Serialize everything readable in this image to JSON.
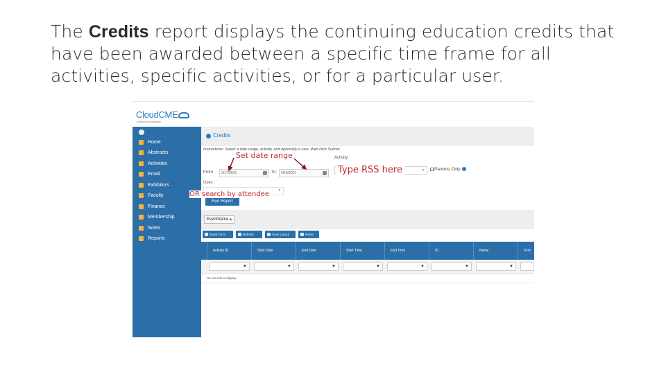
{
  "heading": {
    "pre": "The ",
    "bold": "Credits",
    "post": " report displays the continuing education credits that have been awarded between a specific time frame for all activities, specific activities, or for a particular user."
  },
  "app": {
    "logo": "CloudCME",
    "logo_sub": "American Institution",
    "sidebar": [
      {
        "label": "Home",
        "icon": "map-pin-icon"
      },
      {
        "label": "Abstracts",
        "icon": "document-icon"
      },
      {
        "label": "Activities",
        "icon": "bookmark-icon"
      },
      {
        "label": "Email",
        "icon": "envelope-icon"
      },
      {
        "label": "Exhibitors",
        "icon": "grid-icon"
      },
      {
        "label": "Faculty",
        "icon": "person-icon"
      },
      {
        "label": "Finance",
        "icon": "pie-icon"
      },
      {
        "label": "Membership",
        "icon": "people-icon"
      },
      {
        "label": "Notes",
        "icon": "list-icon"
      },
      {
        "label": "Reports",
        "icon": "bar-chart-icon"
      }
    ],
    "panel_title": "Credits",
    "instructions": "Instructions: Select a date range, activity, and optionally a user, then click Submit",
    "form": {
      "from_label": "From:",
      "from_value": "3/17/2021",
      "to_label": "To:",
      "to_value": "4/16/2021",
      "activity_label": "Activity:",
      "user_label": "User:",
      "parents_only": "Parents Only"
    },
    "run_button": "Run Report",
    "group_button": "EventName",
    "toolbar": [
      "Export XLS",
      "Refresh",
      "Save Layout",
      "Reset"
    ],
    "columns": [
      "Activity ID",
      "Start Date",
      "End Date",
      "Start Time",
      "End Time",
      "ID",
      "Name",
      "First"
    ],
    "no_records": "No records to display."
  },
  "annotations": {
    "date_range": "Set date range",
    "rss": "Type RSS here",
    "attendee": "OR search by attendee"
  },
  "colors": {
    "accent": "#2c6fa8",
    "annotation": "#c0292b",
    "icon": "#f3b340"
  }
}
